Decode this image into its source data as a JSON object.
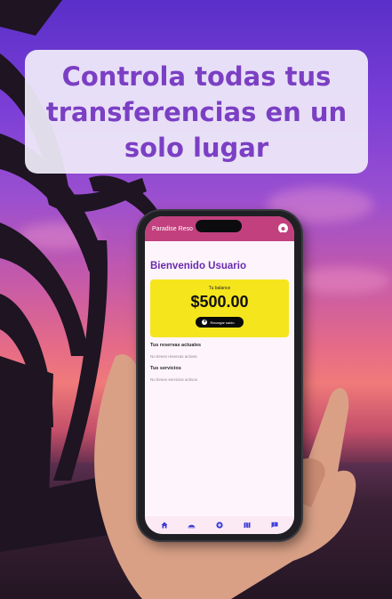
{
  "headline": "Controla todas tus transferencias en un solo lugar",
  "app": {
    "title": "Paradise Reso",
    "welcome": "Bienvenido Usuario",
    "balance": {
      "label": "Tu balance",
      "amount": "$500.00",
      "recharge_label": "Recargar saldo"
    },
    "reservations": {
      "title": "Tus reservas actuales",
      "empty": "No tienes reservas activas"
    },
    "services": {
      "title": "Tus servicios",
      "empty": "No tienes servicios activos"
    },
    "bottom_nav": [
      "home-icon",
      "hotel-icon",
      "add-circle-icon",
      "map-icon",
      "chat-icon"
    ]
  },
  "colors": {
    "headline": "#7b3fc4",
    "appbar": "#c2407e",
    "welcome": "#6a2ab0",
    "balance_card": "#f5e51d",
    "nav_icon": "#3b3bd8"
  }
}
